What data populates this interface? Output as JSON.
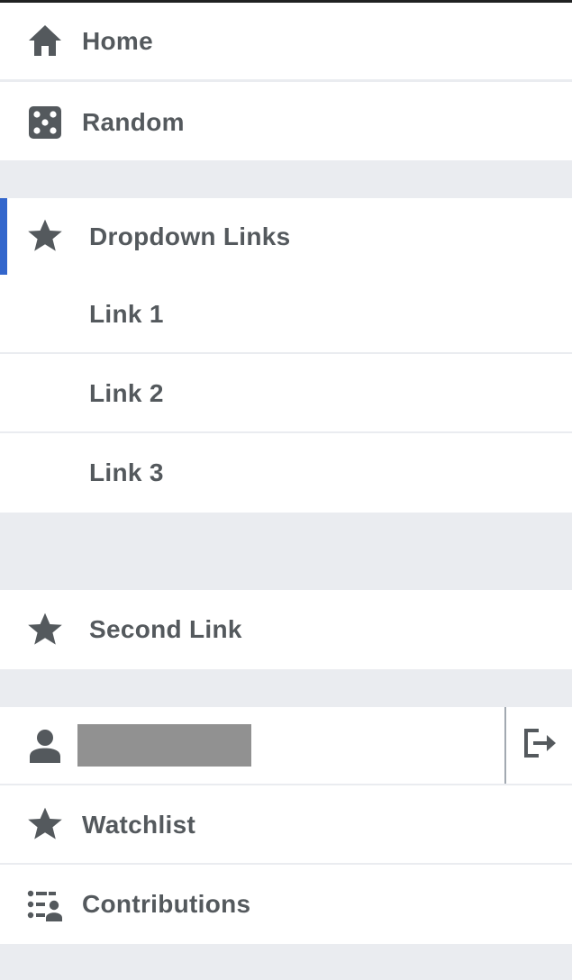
{
  "nav": {
    "home": {
      "label": "Home",
      "icon": "home-icon"
    },
    "random": {
      "label": "Random",
      "icon": "dice-icon"
    },
    "dropdown": {
      "label": "Dropdown Links",
      "icon": "star-icon",
      "expanded": true,
      "links": [
        {
          "label": "Link 1"
        },
        {
          "label": "Link 2"
        },
        {
          "label": "Link 3"
        }
      ]
    },
    "second_link": {
      "label": "Second Link",
      "icon": "star-icon"
    },
    "user": {
      "icon": "user-icon",
      "logout_icon": "logout-icon"
    },
    "watchlist": {
      "label": "Watchlist",
      "icon": "star-icon"
    },
    "contributions": {
      "label": "Contributions",
      "icon": "contributions-icon"
    }
  },
  "colors": {
    "text": "#54595d",
    "divider": "#eaecf0",
    "active_accent": "#3366cc",
    "redacted": "#919191"
  }
}
